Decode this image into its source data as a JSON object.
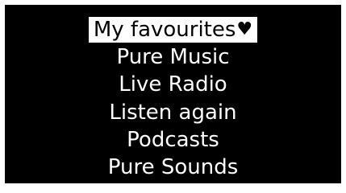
{
  "menu": {
    "items": [
      {
        "label": "My favourites",
        "selected": true,
        "icon": "heart-icon",
        "icon_glyph": "♥"
      },
      {
        "label": "Pure Music"
      },
      {
        "label": "Live Radio"
      },
      {
        "label": "Listen again"
      },
      {
        "label": "Podcasts"
      },
      {
        "label": "Pure Sounds"
      }
    ]
  },
  "colors": {
    "screen_background": "#000000",
    "text": "#ffffff",
    "selection_background": "#ffffff",
    "selection_text": "#000000"
  }
}
